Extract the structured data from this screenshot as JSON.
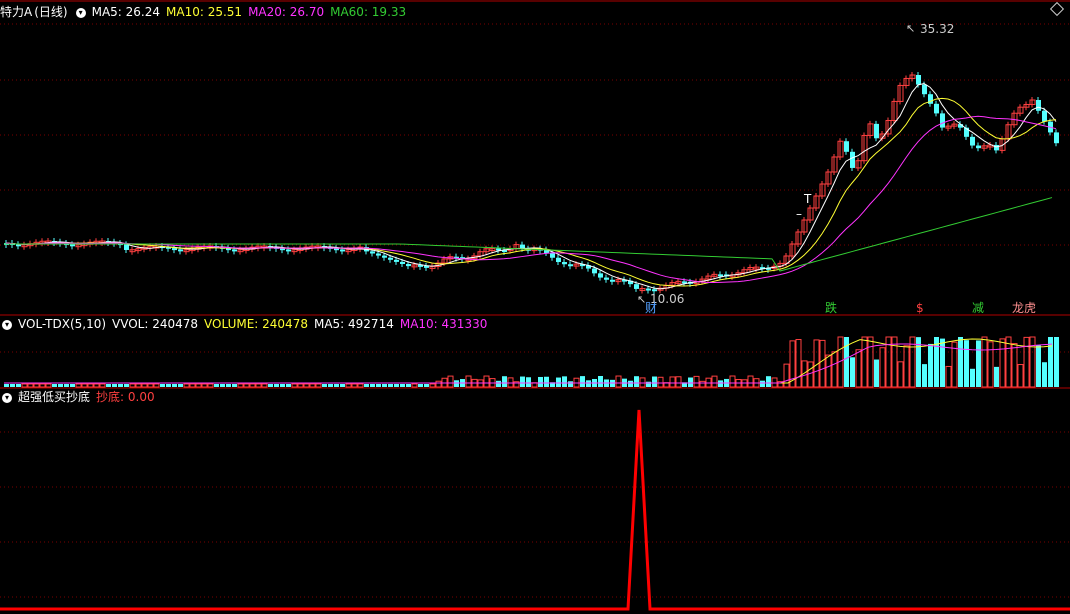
{
  "price_header": {
    "title": "特力A",
    "period": "(日线)",
    "ma5_label": "MA5: 26.24",
    "ma10_label": "MA10: 25.51",
    "ma20_label": "MA20: 26.70",
    "ma60_label": "MA60: 19.33"
  },
  "volume_header": {
    "name": "VOL-TDX(5,10)",
    "vvol_label": "VVOL: 240478",
    "volume_label": "VOLUME: 240478",
    "ma5_label": "MA5: 492714",
    "ma10_label": "MA10: 431330"
  },
  "indicator_header": {
    "name": "超强低买抄底",
    "value_label": "抄底: 0.00"
  },
  "annotations": {
    "high_label": "35.32",
    "low_label": "10.06",
    "t_mark": "T",
    "dash_mark": "–",
    "event_low": "财",
    "event_1": "跌",
    "event_2": "$",
    "event_3": "减",
    "event_4": "龙虎"
  },
  "colors": {
    "background": "#000000",
    "up": "#ff4040",
    "down": "#54ffff",
    "ma5": "#ffffff",
    "ma10": "#ffff33",
    "ma20": "#ff33ff",
    "ma60": "#33cc33",
    "grid": "#7a0000",
    "indicator": "#ff0000"
  }
}
